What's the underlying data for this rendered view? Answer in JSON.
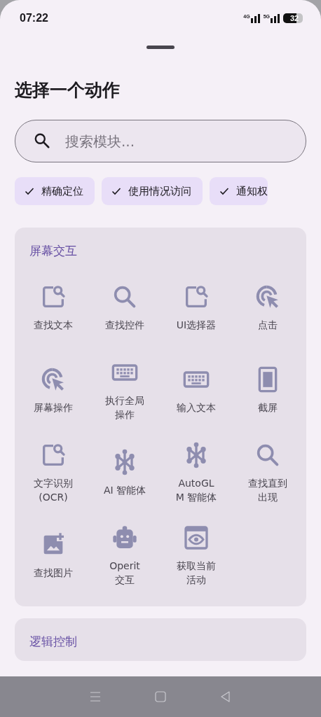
{
  "status_bar": {
    "time": "07:22",
    "network_1": "4G",
    "network_2": "5G",
    "battery": "32"
  },
  "title": "选择一个动作",
  "search": {
    "placeholder": "搜索模块..."
  },
  "chips": [
    {
      "label": "精确定位",
      "checked": true
    },
    {
      "label": "使用情况访问",
      "checked": true
    },
    {
      "label": "通知权",
      "checked": true
    }
  ],
  "sections": [
    {
      "title": "屏幕交互",
      "items": [
        {
          "label": "查找文本",
          "kind": "findtext"
        },
        {
          "label": "查找控件",
          "kind": "search"
        },
        {
          "label": "UI选择器",
          "kind": "findtext"
        },
        {
          "label": "点击",
          "kind": "tap"
        },
        {
          "label": "屏幕操作",
          "kind": "tap"
        },
        {
          "label": "执行全局操作",
          "kind": "keyboard"
        },
        {
          "label": "输入文本",
          "kind": "keyboard"
        },
        {
          "label": "截屏",
          "kind": "phone"
        },
        {
          "label": "文字识别 (OCR)",
          "kind": "findtext"
        },
        {
          "label": "AI 智能体",
          "kind": "network"
        },
        {
          "label": "AutoGLM 智能体",
          "kind": "network"
        },
        {
          "label": "查找直到出现",
          "kind": "search"
        },
        {
          "label": "查找图片",
          "kind": "image"
        },
        {
          "label": "Operit 交互",
          "kind": "robot"
        },
        {
          "label": "获取当前活动",
          "kind": "eye"
        }
      ]
    },
    {
      "title": "逻辑控制"
    }
  ]
}
